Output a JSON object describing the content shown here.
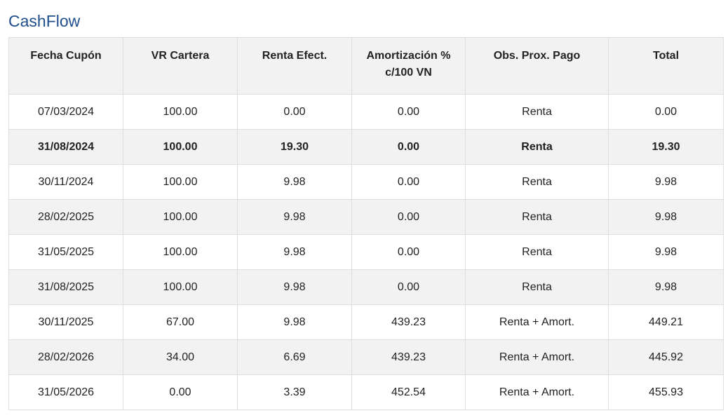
{
  "title": "CashFlow",
  "columns": [
    "Fecha Cupón",
    "VR Cartera",
    "Renta Efect.",
    "Amortización % c/100 VN",
    "Obs. Prox. Pago",
    "Total"
  ],
  "rows": [
    {
      "fecha": "07/03/2024",
      "vr_cartera": "100.00",
      "renta": "0.00",
      "amortizacion": "0.00",
      "obs": "Renta",
      "total": "0.00",
      "highlight": false
    },
    {
      "fecha": "31/08/2024",
      "vr_cartera": "100.00",
      "renta": "19.30",
      "amortizacion": "0.00",
      "obs": "Renta",
      "total": "19.30",
      "highlight": true
    },
    {
      "fecha": "30/11/2024",
      "vr_cartera": "100.00",
      "renta": "9.98",
      "amortizacion": "0.00",
      "obs": "Renta",
      "total": "9.98",
      "highlight": false
    },
    {
      "fecha": "28/02/2025",
      "vr_cartera": "100.00",
      "renta": "9.98",
      "amortizacion": "0.00",
      "obs": "Renta",
      "total": "9.98",
      "highlight": false
    },
    {
      "fecha": "31/05/2025",
      "vr_cartera": "100.00",
      "renta": "9.98",
      "amortizacion": "0.00",
      "obs": "Renta",
      "total": "9.98",
      "highlight": false
    },
    {
      "fecha": "31/08/2025",
      "vr_cartera": "100.00",
      "renta": "9.98",
      "amortizacion": "0.00",
      "obs": "Renta",
      "total": "9.98",
      "highlight": false
    },
    {
      "fecha": "30/11/2025",
      "vr_cartera": "67.00",
      "renta": "9.98",
      "amortizacion": "439.23",
      "obs": "Renta + Amort.",
      "total": "449.21",
      "highlight": false
    },
    {
      "fecha": "28/02/2026",
      "vr_cartera": "34.00",
      "renta": "6.69",
      "amortizacion": "439.23",
      "obs": "Renta + Amort.",
      "total": "445.92",
      "highlight": false
    },
    {
      "fecha": "31/05/2026",
      "vr_cartera": "0.00",
      "renta": "3.39",
      "amortizacion": "452.54",
      "obs": "Renta + Amort.",
      "total": "455.93",
      "highlight": false
    }
  ],
  "colors": {
    "title": "#1f4e8c",
    "header_bg": "#f2f2f2",
    "stripe_bg": "#f2f2f2",
    "border": "#dedede"
  }
}
